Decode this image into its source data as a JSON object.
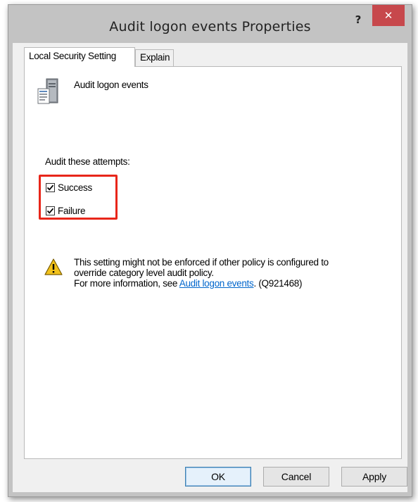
{
  "window": {
    "title": "Audit logon events Properties",
    "help_label": "?",
    "close_label": "✕"
  },
  "tabs": [
    {
      "label": "Local Security Setting",
      "active": true
    },
    {
      "label": "Explain",
      "active": false
    }
  ],
  "policy": {
    "name": "Audit logon events",
    "icon": "policy-computer-icon"
  },
  "audit": {
    "label": "Audit these attempts:",
    "options": [
      {
        "label": "Success",
        "checked": true
      },
      {
        "label": "Failure",
        "checked": true
      }
    ],
    "highlight_color": "#e8261a"
  },
  "warning": {
    "icon": "warning-icon",
    "line1": "This setting might not be enforced if other policy is configured to",
    "line2": "override category level audit policy.",
    "line3_prefix": "For more information, see ",
    "link_text": "Audit logon events",
    "line3_suffix": ". (Q921468)"
  },
  "buttons": {
    "ok": "OK",
    "cancel": "Cancel",
    "apply": "Apply"
  },
  "colors": {
    "close_button": "#c7484c",
    "link": "#0066cc"
  }
}
